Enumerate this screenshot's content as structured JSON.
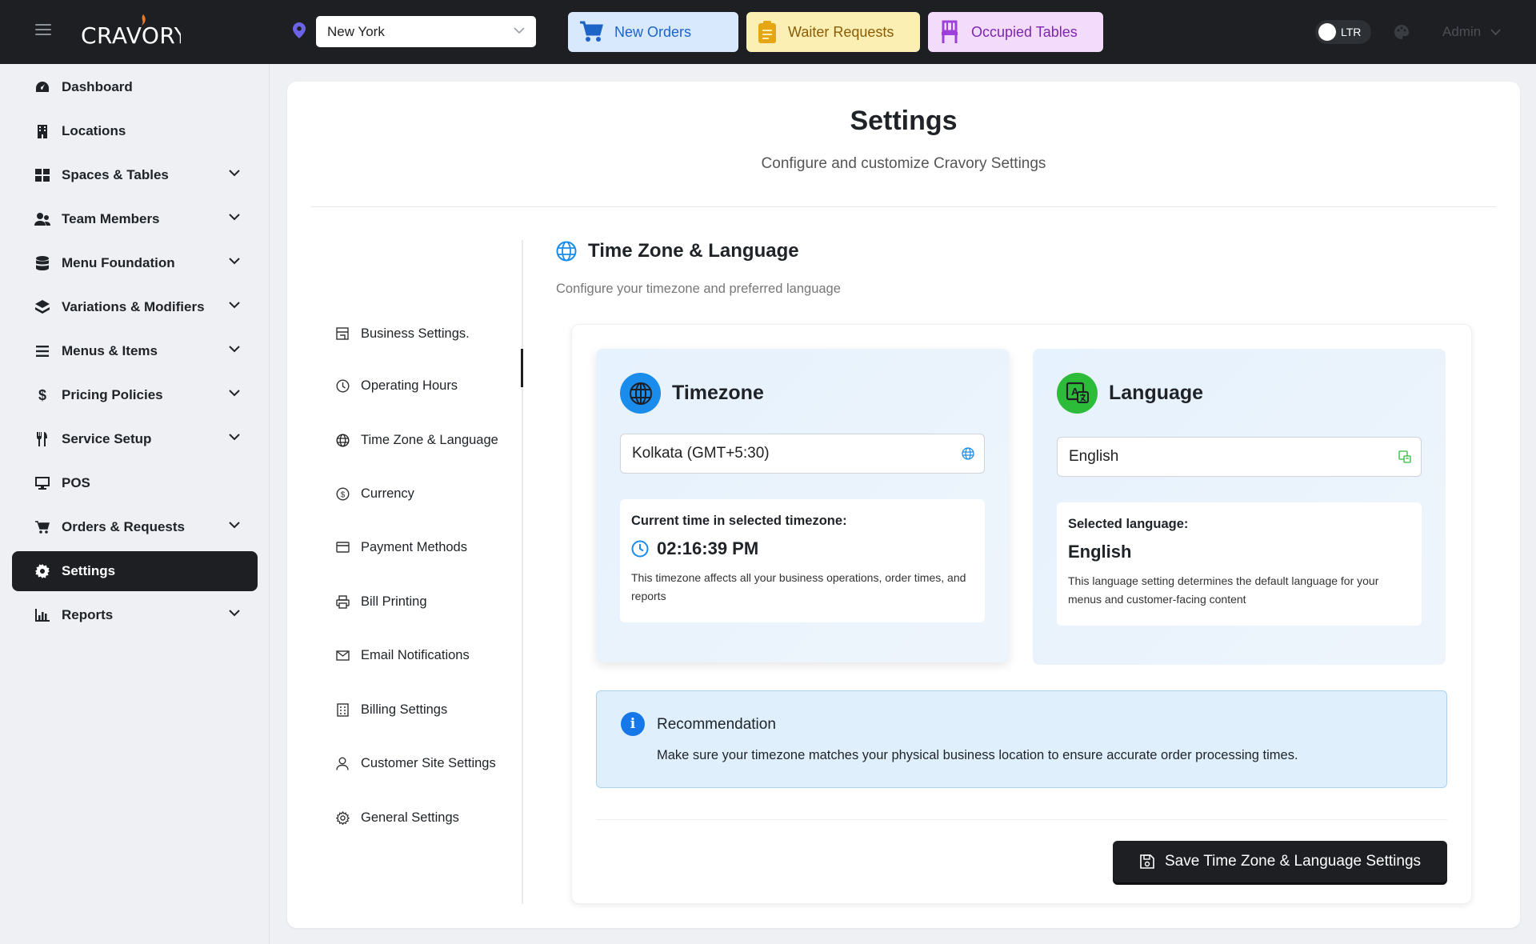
{
  "topbar": {
    "brand": "CRAVORY",
    "location": "New York",
    "quick_actions": [
      {
        "label": "New Orders",
        "icon": "cart-icon"
      },
      {
        "label": "Waiter Requests",
        "icon": "clipboard-icon"
      },
      {
        "label": "Occupied Tables",
        "icon": "chair-icon"
      }
    ],
    "direction_label": "LTR",
    "user": "Admin"
  },
  "sidebar": {
    "items": [
      {
        "label": "Dashboard",
        "icon": "dashboard-icon",
        "expandable": false
      },
      {
        "label": "Locations",
        "icon": "building-icon",
        "expandable": false
      },
      {
        "label": "Spaces & Tables",
        "icon": "grid-icon",
        "expandable": true
      },
      {
        "label": "Team Members",
        "icon": "users-icon",
        "expandable": true
      },
      {
        "label": "Menu Foundation",
        "icon": "database-icon",
        "expandable": true
      },
      {
        "label": "Variations & Modifiers",
        "icon": "layers-icon",
        "expandable": true
      },
      {
        "label": "Menus & Items",
        "icon": "list-icon",
        "expandable": true
      },
      {
        "label": "Pricing Policies",
        "icon": "dollar-icon",
        "expandable": true
      },
      {
        "label": "Service Setup",
        "icon": "utensils-icon",
        "expandable": true
      },
      {
        "label": "POS",
        "icon": "monitor-icon",
        "expandable": false
      },
      {
        "label": "Orders & Requests",
        "icon": "cart-icon",
        "expandable": true
      },
      {
        "label": "Settings",
        "icon": "gear-icon",
        "expandable": false,
        "active": true
      },
      {
        "label": "Reports",
        "icon": "chart-icon",
        "expandable": true
      }
    ]
  },
  "page": {
    "title": "Settings",
    "subtitle": "Configure and customize Cravory Settings"
  },
  "settings_nav": [
    {
      "label": "Business Settings.",
      "icon": "store-icon"
    },
    {
      "label": "Operating Hours",
      "icon": "clock-icon"
    },
    {
      "label": "Time Zone & Language",
      "icon": "globe-icon",
      "active": true
    },
    {
      "label": "Currency",
      "icon": "currency-icon"
    },
    {
      "label": "Payment Methods",
      "icon": "credit-card-icon"
    },
    {
      "label": "Bill Printing",
      "icon": "printer-icon"
    },
    {
      "label": "Email Notifications",
      "icon": "mail-icon"
    },
    {
      "label": "Billing Settings",
      "icon": "calculator-icon"
    },
    {
      "label": "Customer Site Settings",
      "icon": "user-icon"
    },
    {
      "label": "General Settings",
      "icon": "cog-icon"
    }
  ],
  "section": {
    "title": "Time Zone & Language",
    "subtitle": "Configure your timezone and preferred language"
  },
  "timezone": {
    "title": "Timezone",
    "value": "Kolkata (GMT+5:30)",
    "current_label": "Current time in selected timezone:",
    "current_time": "02:16:39 PM",
    "note": "This timezone affects all your business operations, order times, and reports"
  },
  "language": {
    "title": "Language",
    "value": "English",
    "selected_label": "Selected language:",
    "selected_value": "English",
    "note": "This language setting determines the default language for your menus and customer-facing content"
  },
  "recommendation": {
    "title": "Recommendation",
    "text": "Make sure your timezone matches your physical business location to ensure accurate order processing times."
  },
  "save_label": "Save Time Zone & Language Settings",
  "colors": {
    "topbar": "#1d1f22",
    "accent_blue": "#1a8cec",
    "accent_green": "#2dbb3a",
    "orders_bg": "#d8e9fd",
    "waiter_bg": "#fbefb4",
    "tables_bg": "#f3dcfb"
  }
}
